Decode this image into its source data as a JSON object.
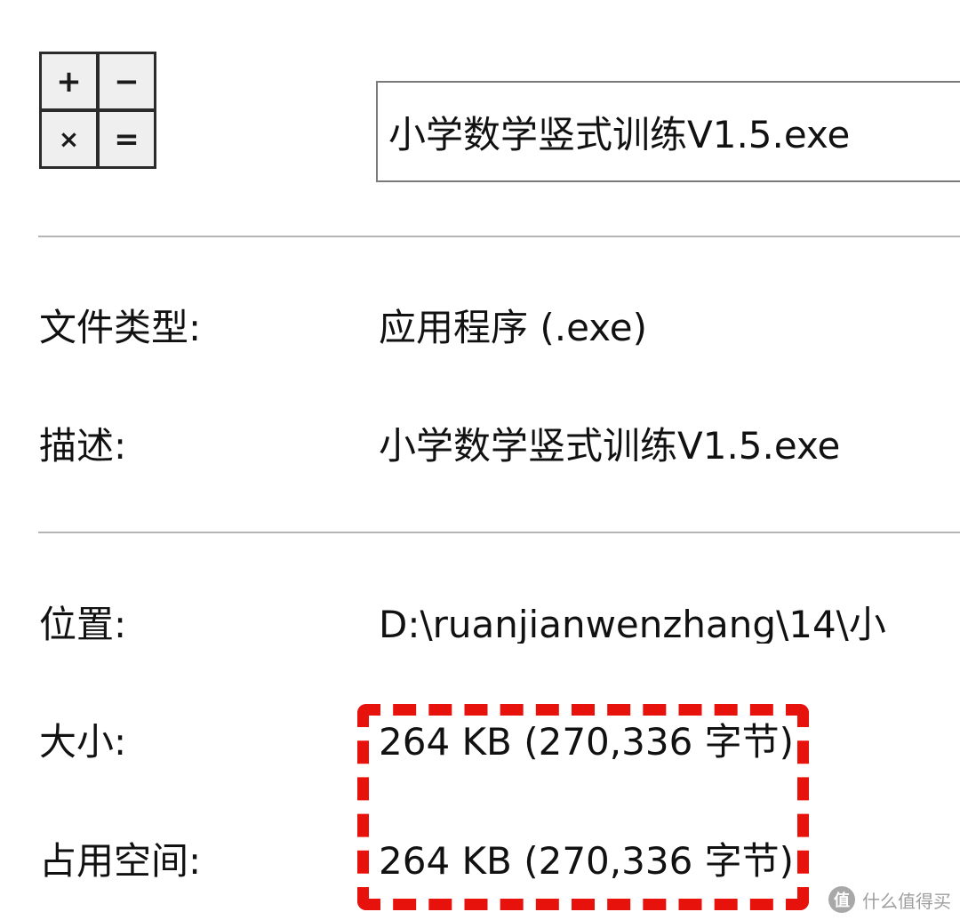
{
  "icon": {
    "name": "calculator-operators-icon",
    "keys": [
      "+",
      "−",
      "×",
      "="
    ]
  },
  "file": {
    "name": "小学数学竖式训练V1.5.exe"
  },
  "properties": {
    "type": {
      "label": "文件类型:",
      "value": "应用程序 (.exe)"
    },
    "description": {
      "label": "描述:",
      "value": "小学数学竖式训练V1.5.exe"
    },
    "location": {
      "label": "位置:",
      "value": "D:\\ruanjianwenzhang\\14\\小"
    },
    "size": {
      "label": "大小:",
      "value": "264 KB (270,336 字节)"
    },
    "size_on_disk": {
      "label": "占用空间:",
      "value": "264 KB (270,336 字节)"
    }
  },
  "annotation": {
    "color": "#e8120c",
    "style": "dashed-highlight"
  },
  "watermark": {
    "logo": "值",
    "text": "什么值得买"
  }
}
